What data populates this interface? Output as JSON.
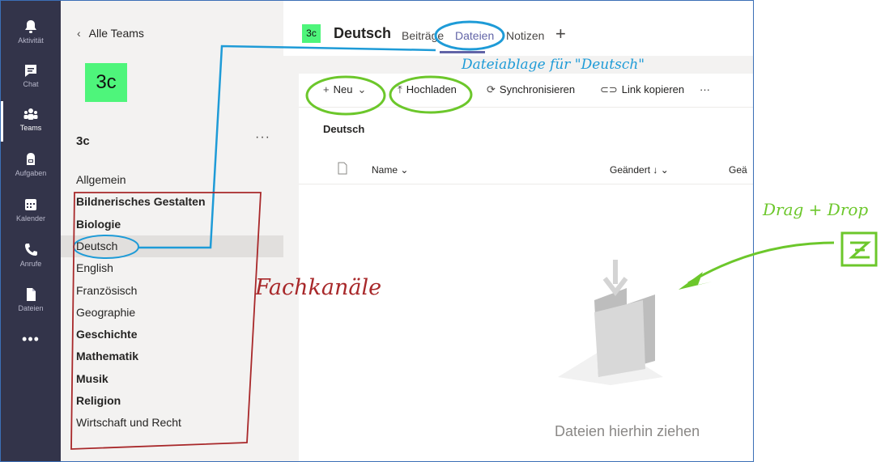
{
  "rail": {
    "items": [
      {
        "label": "Aktivität",
        "icon": "bell-icon"
      },
      {
        "label": "Chat",
        "icon": "chat-icon"
      },
      {
        "label": "Teams",
        "icon": "teams-icon"
      },
      {
        "label": "Aufgaben",
        "icon": "assignments-icon"
      },
      {
        "label": "Kalender",
        "icon": "calendar-icon"
      },
      {
        "label": "Anrufe",
        "icon": "phone-icon"
      },
      {
        "label": "Dateien",
        "icon": "file-icon"
      }
    ],
    "more": "•••"
  },
  "panel": {
    "back_label": "Alle Teams",
    "team_avatar": "3c",
    "team_name": "3c",
    "more": "···",
    "channels": [
      {
        "label": "Allgemein",
        "bold": false
      },
      {
        "label": "Bildnerisches Gestalten",
        "bold": true
      },
      {
        "label": "Biologie",
        "bold": true
      },
      {
        "label": "Deutsch",
        "bold": false,
        "selected": true
      },
      {
        "label": "English",
        "bold": false
      },
      {
        "label": "Französisch",
        "bold": false
      },
      {
        "label": "Geographie",
        "bold": false
      },
      {
        "label": "Geschichte",
        "bold": true
      },
      {
        "label": "Mathematik",
        "bold": true
      },
      {
        "label": "Musik",
        "bold": true
      },
      {
        "label": "Religion",
        "bold": true
      },
      {
        "label": "Wirtschaft und Recht",
        "bold": false
      }
    ]
  },
  "header": {
    "avatar": "3c",
    "title": "Deutsch",
    "tabs": [
      "Beiträge",
      "Dateien",
      "Notizen"
    ],
    "add": "+"
  },
  "toolbar": {
    "new_label": "Neu",
    "upload_label": "Hochladen",
    "sync_label": "Synchronisieren",
    "copy_link_label": "Link kopieren",
    "more": "···"
  },
  "files": {
    "folder_title": "Deutsch",
    "columns": {
      "name": "Name",
      "modified": "Geändert",
      "modified_by": "Geä"
    },
    "empty_text": "Dateien hierhin ziehen"
  },
  "annotations": {
    "files_note": "Dateiablage für \"Deutsch\"",
    "channels_note": "Fachkanäle",
    "dragdrop_note": "Drag + Drop",
    "colors": {
      "blue": "#1e9bd7",
      "green": "#6cc72b",
      "red": "#a8282a"
    }
  },
  "theme": {
    "rail_bg": "#33344a",
    "accent": "#6264a7",
    "team_color": "#4ef57b"
  }
}
